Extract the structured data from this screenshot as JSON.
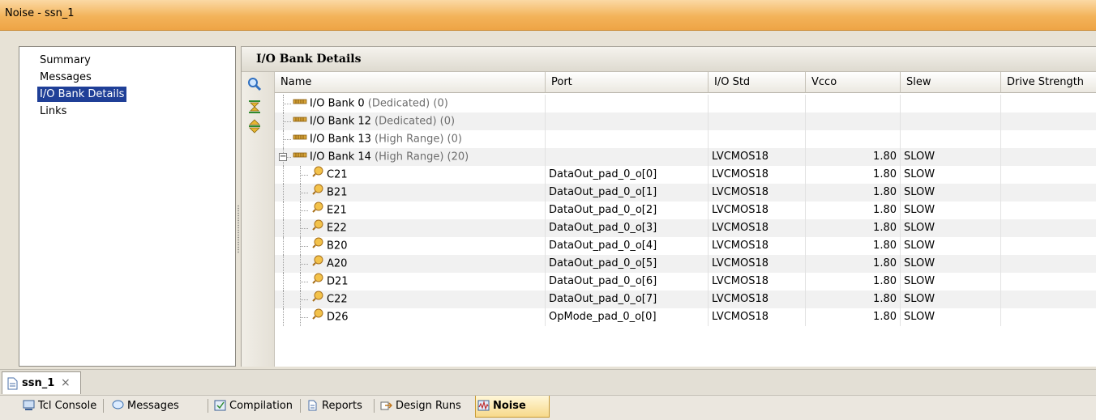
{
  "window": {
    "title": "Noise - ssn_1"
  },
  "nav": {
    "items": [
      "Summary",
      "Messages",
      "I/O Bank Details",
      "Links"
    ],
    "selected_index": 2
  },
  "details": {
    "title": "I/O Bank Details",
    "columns": [
      "Name",
      "Port",
      "I/O Std",
      "Vcco",
      "Slew",
      "Drive Strength"
    ],
    "rows": [
      {
        "name": "I/O Bank 0",
        "suffix": " (Dedicated) (0)",
        "kind": "bank",
        "port": "",
        "std": "",
        "vcco": "",
        "slew": ""
      },
      {
        "name": "I/O Bank 12",
        "suffix": " (Dedicated) (0)",
        "kind": "bank",
        "port": "",
        "std": "",
        "vcco": "",
        "slew": ""
      },
      {
        "name": "I/O Bank 13",
        "suffix": " (High Range) (0)",
        "kind": "bank",
        "port": "",
        "std": "",
        "vcco": "",
        "slew": ""
      },
      {
        "name": "I/O Bank 14",
        "suffix": " (High Range) (20)",
        "kind": "bank-open",
        "port": "",
        "std": "LVCMOS18",
        "vcco": "1.80",
        "slew": "SLOW"
      },
      {
        "name": "C21",
        "suffix": "",
        "kind": "pin",
        "port": "DataOut_pad_0_o[0]",
        "std": "LVCMOS18",
        "vcco": "1.80",
        "slew": "SLOW"
      },
      {
        "name": "B21",
        "suffix": "",
        "kind": "pin",
        "port": "DataOut_pad_0_o[1]",
        "std": "LVCMOS18",
        "vcco": "1.80",
        "slew": "SLOW"
      },
      {
        "name": "E21",
        "suffix": "",
        "kind": "pin",
        "port": "DataOut_pad_0_o[2]",
        "std": "LVCMOS18",
        "vcco": "1.80",
        "slew": "SLOW"
      },
      {
        "name": "E22",
        "suffix": "",
        "kind": "pin",
        "port": "DataOut_pad_0_o[3]",
        "std": "LVCMOS18",
        "vcco": "1.80",
        "slew": "SLOW"
      },
      {
        "name": "B20",
        "suffix": "",
        "kind": "pin",
        "port": "DataOut_pad_0_o[4]",
        "std": "LVCMOS18",
        "vcco": "1.80",
        "slew": "SLOW"
      },
      {
        "name": "A20",
        "suffix": "",
        "kind": "pin",
        "port": "DataOut_pad_0_o[5]",
        "std": "LVCMOS18",
        "vcco": "1.80",
        "slew": "SLOW"
      },
      {
        "name": "D21",
        "suffix": "",
        "kind": "pin",
        "port": "DataOut_pad_0_o[6]",
        "std": "LVCMOS18",
        "vcco": "1.80",
        "slew": "SLOW"
      },
      {
        "name": "C22",
        "suffix": "",
        "kind": "pin",
        "port": "DataOut_pad_0_o[7]",
        "std": "LVCMOS18",
        "vcco": "1.80",
        "slew": "SLOW"
      },
      {
        "name": "D26",
        "suffix": "",
        "kind": "pin",
        "port": "OpMode_pad_0_o[0]",
        "std": "LVCMOS18",
        "vcco": "1.80",
        "slew": "SLOW"
      }
    ]
  },
  "doc_tab": {
    "label": "ssn_1",
    "close": "×"
  },
  "bottom_tabs": [
    {
      "label": "Tcl Console",
      "icon": "console-icon"
    },
    {
      "label": "Messages",
      "icon": "speech-bubble-icon"
    },
    {
      "label": "Compilation",
      "icon": "compile-icon"
    },
    {
      "label": "Reports",
      "icon": "document-icon"
    },
    {
      "label": "Design Runs",
      "icon": "runs-icon"
    },
    {
      "label": "Noise",
      "icon": "noise-icon",
      "active": true
    }
  ],
  "colors": {
    "title_orange": "#f3b35a",
    "selection_blue": "#1f3f97",
    "active_tab": "#f7d98b"
  }
}
